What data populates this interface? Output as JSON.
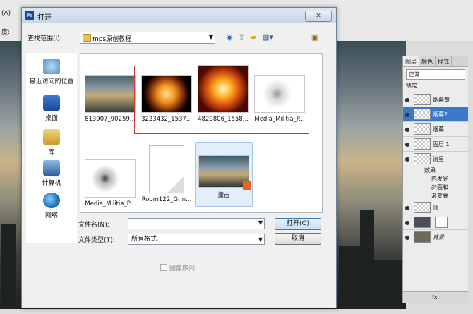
{
  "background": {
    "menu_fragment": "(A)",
    "options_fragment": "度:"
  },
  "layers_panel": {
    "tabs": [
      "图层",
      "颜色",
      "样式"
    ],
    "blend_mode": "正常",
    "lock_label": "锁定:",
    "layers": [
      {
        "name": "烟幕黄"
      },
      {
        "name": "烟幕2",
        "selected": true
      },
      {
        "name": "烟幕"
      },
      {
        "name": "图层 1"
      },
      {
        "name": "流星"
      },
      {
        "name": "效果"
      },
      {
        "name": "内发光"
      },
      {
        "name": "斜面和"
      },
      {
        "name": "渐变叠"
      },
      {
        "name": "顶"
      },
      {
        "name": ""
      },
      {
        "name": "背景"
      }
    ],
    "bottom_icons": "fx."
  },
  "dialog": {
    "logo": "Ps",
    "title": "打开",
    "lookin_label": "查找范围(I):",
    "lookin_value": "mps原创教程",
    "places": [
      "最近访问的位置",
      "桌面",
      "库",
      "计算机",
      "网络"
    ],
    "files": [
      {
        "name": "813907_90259...",
        "thumb": "city"
      },
      {
        "name": "3223432_1537...",
        "thumb": "explosion"
      },
      {
        "name": "4820806_1558...",
        "thumb": "blast"
      },
      {
        "name": "Media_Militia_P...",
        "thumb": "particles"
      },
      {
        "name": "Media_Militia_P...",
        "thumb": "debris"
      },
      {
        "name": "Room122_Grin...",
        "thumb": "blank"
      },
      {
        "name": "撞击",
        "thumb": "psd"
      }
    ],
    "filename_label": "文件名(N):",
    "filename_value": "",
    "filetype_label": "文件类型(T):",
    "filetype_value": "所有格式",
    "open_button": "打开(O)",
    "cancel_button": "取消",
    "image_sequence": "图像序列"
  }
}
